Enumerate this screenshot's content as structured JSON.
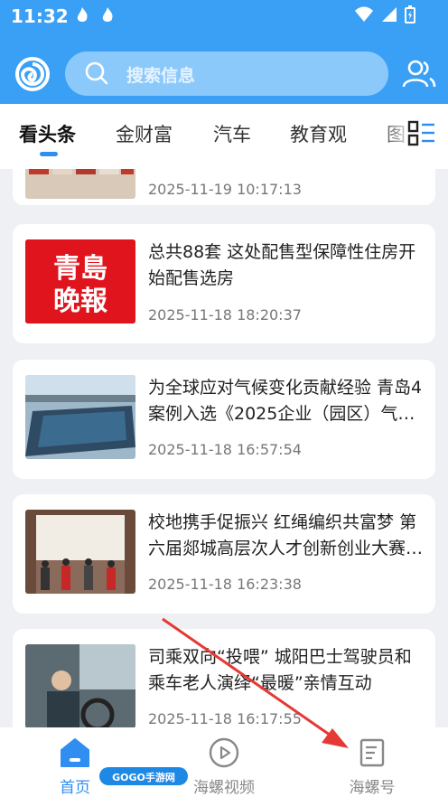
{
  "status": {
    "time": "11:32",
    "icons": [
      "flame-icon",
      "flame-icon",
      "wifi-icon",
      "signal-icon",
      "battery-icon"
    ]
  },
  "header": {
    "search_placeholder": "搜索信息"
  },
  "tabs": [
    {
      "label": "看头条",
      "active": true
    },
    {
      "label": "金财富",
      "active": false
    },
    {
      "label": "汽车",
      "active": false
    },
    {
      "label": "教育观",
      "active": false
    },
    {
      "label": "图",
      "active": false
    }
  ],
  "articles": [
    {
      "title": "",
      "date": "2025-11-19 10:17:13",
      "thumb": "exhibition-boards"
    },
    {
      "title": "总共88套 这处配售型保障性住房开始配售选房",
      "date": "2025-11-18 18:20:37",
      "thumb": "newspaper-logo",
      "thumb_text": "青島晚報"
    },
    {
      "title": "为全球应对气候变化贡献经验 青岛4案例入选《2025企业（园区）气…",
      "date": "2025-11-18 16:57:54",
      "thumb": "solar-farm"
    },
    {
      "title": "校地携手促振兴 红绳编织共富梦 第六届郯城高层次人才创新创业大赛…",
      "date": "2025-11-18 16:23:38",
      "thumb": "group-photo"
    },
    {
      "title": "司乘双向“投喂” 城阳巴士驾驶员和乘车老人演绎“最暖”亲情互动",
      "date": "2025-11-18 16:17:55",
      "thumb": "bus-driver"
    }
  ],
  "bottom_nav": [
    {
      "label": "首页",
      "icon": "home-icon",
      "active": true
    },
    {
      "label": "海螺视频",
      "icon": "play-icon",
      "active": false
    },
    {
      "label": "海螺号",
      "icon": "document-icon",
      "active": false
    }
  ],
  "watermark": "GOGO手游网",
  "colors": {
    "primary": "#3aa0f5",
    "active_tab_underline": "#2f8ef0",
    "annotation_arrow": "#e53935"
  }
}
